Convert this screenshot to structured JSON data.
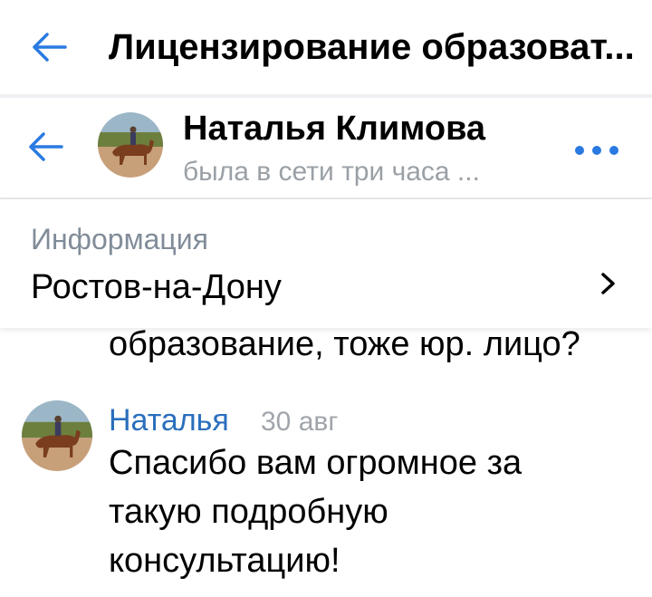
{
  "header": {
    "title": "Лицензирование образоват..."
  },
  "chat": {
    "name": "Наталья Климова",
    "status": "была в сети три часа ..."
  },
  "info": {
    "label": "Информация",
    "value": "Ростов-на-Дону"
  },
  "messages": {
    "previous_text": "образование, тоже юр. лицо?",
    "last": {
      "author": "Наталья",
      "time": "30 авг",
      "text": "Спасибо вам огромное за такую подробную консультацию!"
    }
  },
  "icons": {
    "back": "arrow-left-icon",
    "more": "more-horizontal-icon",
    "chevron": "chevron-right-icon"
  },
  "colors": {
    "accent": "#2a6fbd",
    "muted": "#818c99",
    "status": "#9aa0a6"
  }
}
